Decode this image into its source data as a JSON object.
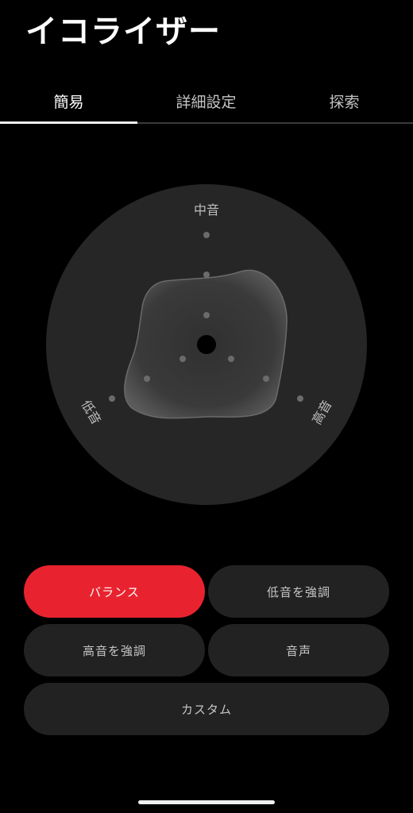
{
  "header": {
    "title": "イコライザー"
  },
  "tabs": [
    {
      "label": "簡易",
      "active": true
    },
    {
      "label": "詳細設定",
      "active": false
    },
    {
      "label": "探索",
      "active": false
    }
  ],
  "equalizer": {
    "labels": {
      "mid": "中音",
      "bass": "低音",
      "treble": "高音"
    },
    "colors": {
      "disc": "#262626",
      "blob": "#4a4a4a",
      "dot": "#6b6b6b",
      "center": "#000000"
    }
  },
  "presets": [
    {
      "label": "バランス",
      "selected": true
    },
    {
      "label": "低音を強調",
      "selected": false
    },
    {
      "label": "高音を強調",
      "selected": false
    },
    {
      "label": "音声",
      "selected": false
    },
    {
      "label": "カスタム",
      "selected": false
    }
  ],
  "colors": {
    "background": "#000000",
    "accent": "#e8232f",
    "button": "#222222"
  }
}
